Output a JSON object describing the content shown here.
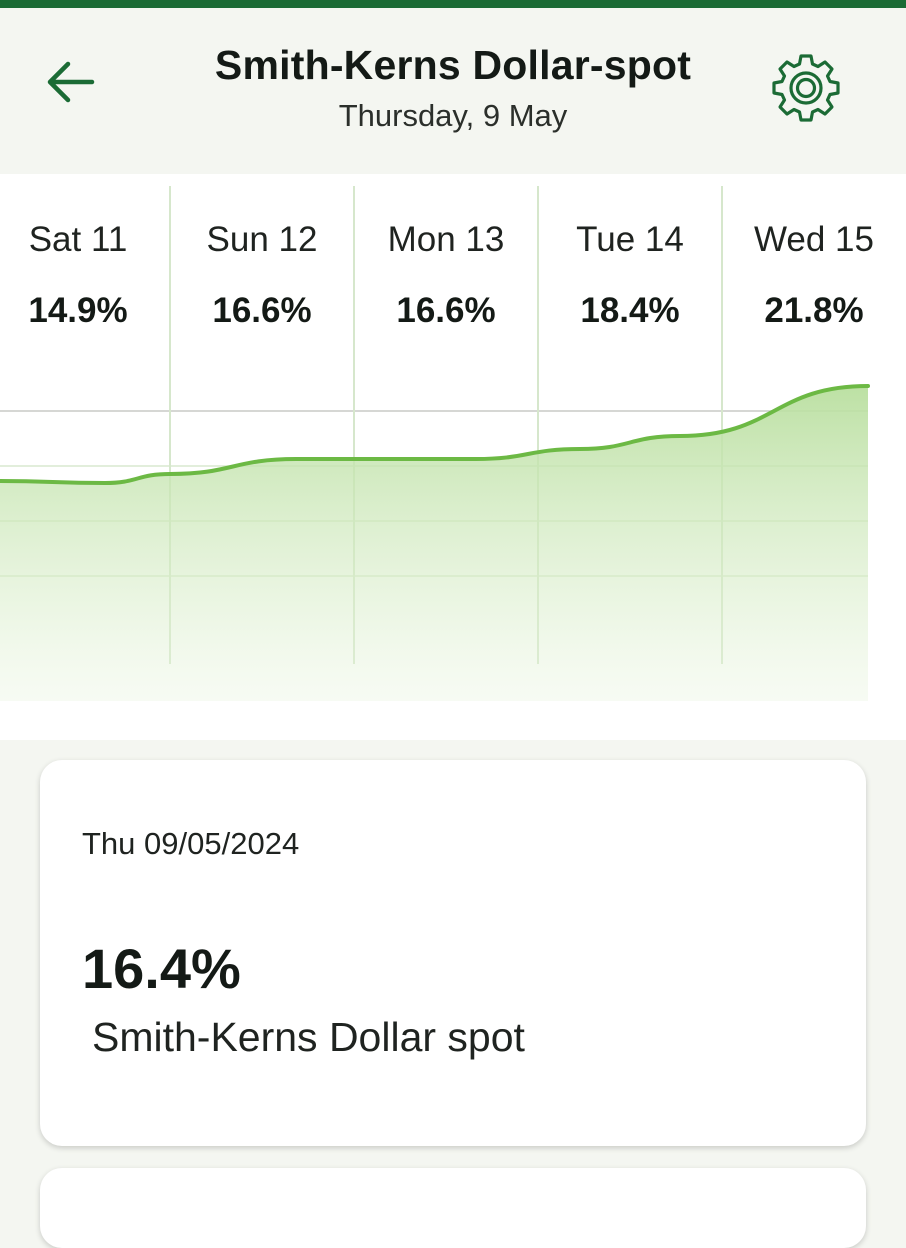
{
  "header": {
    "title": "Smith-Kerns Dollar-spot",
    "subtitle": "Thursday, 9 May",
    "back_icon": "arrow-left-icon",
    "settings_icon": "gear-icon",
    "accent_color": "#1b6b35"
  },
  "forecast": {
    "days": [
      {
        "label": "Sat 11",
        "value": "14.9%"
      },
      {
        "label": "Sun 12",
        "value": "16.6%"
      },
      {
        "label": "Mon 13",
        "value": "16.6%"
      },
      {
        "label": "Tue 14",
        "value": "18.4%"
      },
      {
        "label": "Wed 15",
        "value": "21.8%"
      }
    ],
    "line_color": "#6cb944",
    "fill_color": "#b9df9f"
  },
  "chart_data": {
    "type": "area",
    "categories": [
      "Sat 11",
      "Sun 12",
      "Mon 13",
      "Tue 14",
      "Wed 15"
    ],
    "values": [
      14.9,
      16.6,
      16.6,
      18.4,
      21.8
    ],
    "grid": true
  },
  "detail_card": {
    "date": "Thu 09/05/2024",
    "value": "16.4%",
    "name": "Smith-Kerns Dollar spot"
  }
}
